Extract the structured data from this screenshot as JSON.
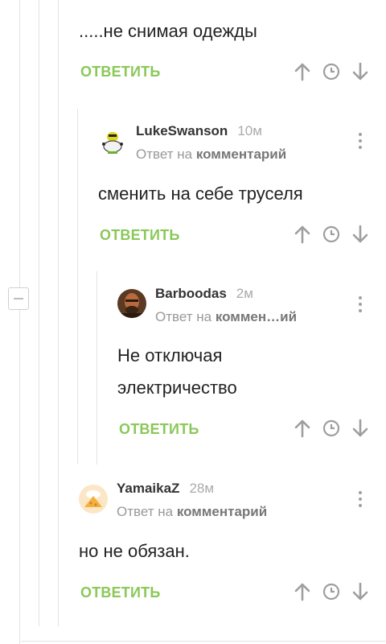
{
  "comments": [
    {
      "text": ".....не снимая одежды",
      "reply": "ОТВЕТИТЬ"
    },
    {
      "user": "LukeSwanson",
      "time": "10м",
      "reply_to_prefix": "Ответ на",
      "reply_to_target": "комментарий",
      "text": "сменить на себе труселя",
      "reply": "ОТВЕТИТЬ"
    },
    {
      "user": "Barboodas",
      "time": "2м",
      "reply_to_prefix": "Ответ на",
      "reply_to_target": "коммен…ий",
      "text_line1": "Не отключая",
      "text_line2": "электричество",
      "reply": "ОТВЕТИТЬ"
    },
    {
      "user": "YamaikaZ",
      "time": "28м",
      "reply_to_prefix": "Ответ на",
      "reply_to_target": "комментарий",
      "text": "но не обязан.",
      "reply": "ОТВЕТИТЬ"
    }
  ],
  "icons": {
    "upvote": "arrow-up-icon",
    "time": "clock-icon",
    "downvote": "arrow-down-icon",
    "menu": "more-vertical-icon"
  },
  "colors": {
    "reply": "#8ac858",
    "icon": "#9e9e9e"
  }
}
